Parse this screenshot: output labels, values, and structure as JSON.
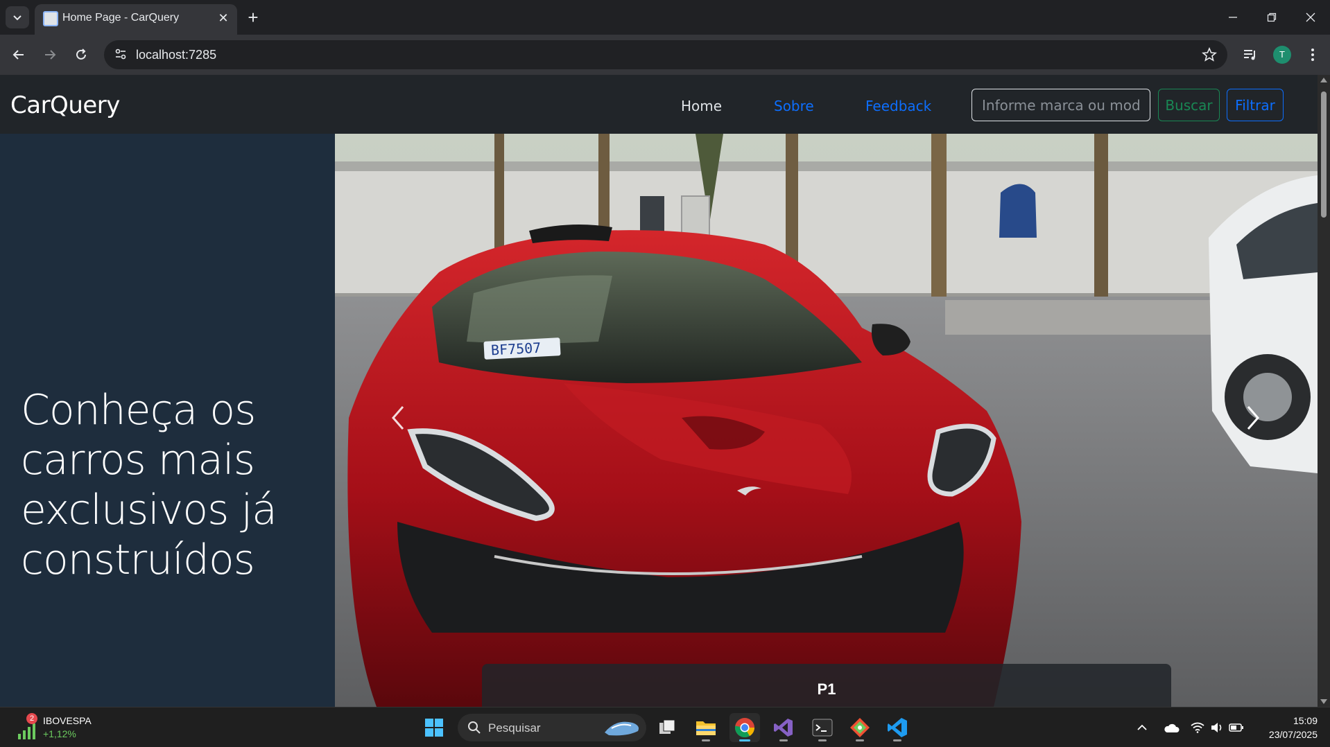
{
  "browser": {
    "tab_title": "Home Page - CarQuery",
    "url": "localhost:7285",
    "profile_initial": "T"
  },
  "site": {
    "brand": "CarQuery",
    "nav": {
      "home": "Home",
      "sobre": "Sobre",
      "feedback": "Feedback"
    },
    "search_placeholder": "Informe marca ou modelo",
    "buscar_label": "Buscar",
    "filtrar_label": "Filtrar",
    "hero_heading": "Conheça os carros mais exclusivos já construídos",
    "carousel": {
      "caption": "P1",
      "plate_text": "BF7507"
    }
  },
  "taskbar": {
    "widget_badge": "2",
    "widget_name": "IBOVESPA",
    "widget_change": "+1,12%",
    "search_label": "Pesquisar",
    "time": "15:09",
    "date": "23/07/2025"
  },
  "colors": {
    "navbar_bg": "#212529",
    "hero_left_bg": "#1e2d3d",
    "link_blue": "#0d6efd",
    "success_green": "#198754",
    "car_red": "#b3141c"
  }
}
